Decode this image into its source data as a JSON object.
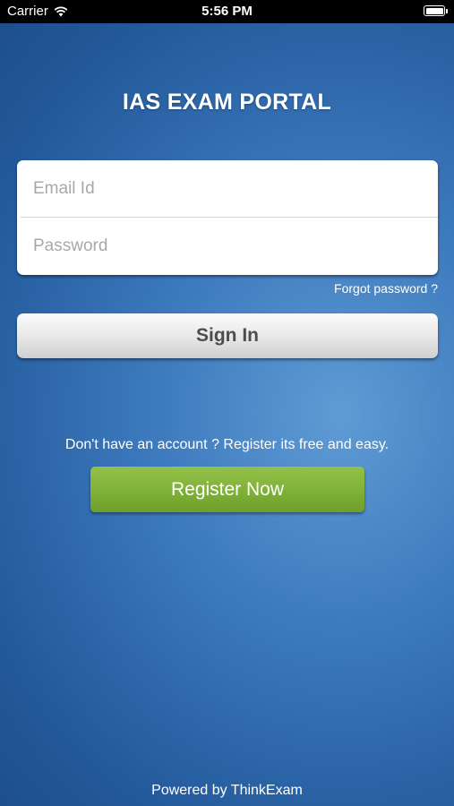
{
  "status_bar": {
    "carrier": "Carrier",
    "time": "5:56 PM",
    "battery_level": 1.0
  },
  "app": {
    "title": "IAS EXAM PORTAL"
  },
  "login": {
    "email_placeholder": "Email Id",
    "email_value": "",
    "password_placeholder": "Password",
    "password_value": "",
    "forgot_label": "Forgot password ?",
    "sign_in_label": "Sign In"
  },
  "register": {
    "hint": "Don't have an account ? Register its free and easy.",
    "button_label": "Register Now"
  },
  "footer": {
    "powered_by": "Powered by ThinkExam"
  },
  "colors": {
    "background_center": "#5f9bd4",
    "background_edge": "#1d4f8d",
    "register_button": "#7fb137",
    "sign_in_button": "#e9e9e9",
    "sign_in_text": "#4d4d4d"
  },
  "icons": {
    "signal": "wifi-icon",
    "battery": "battery-icon"
  }
}
